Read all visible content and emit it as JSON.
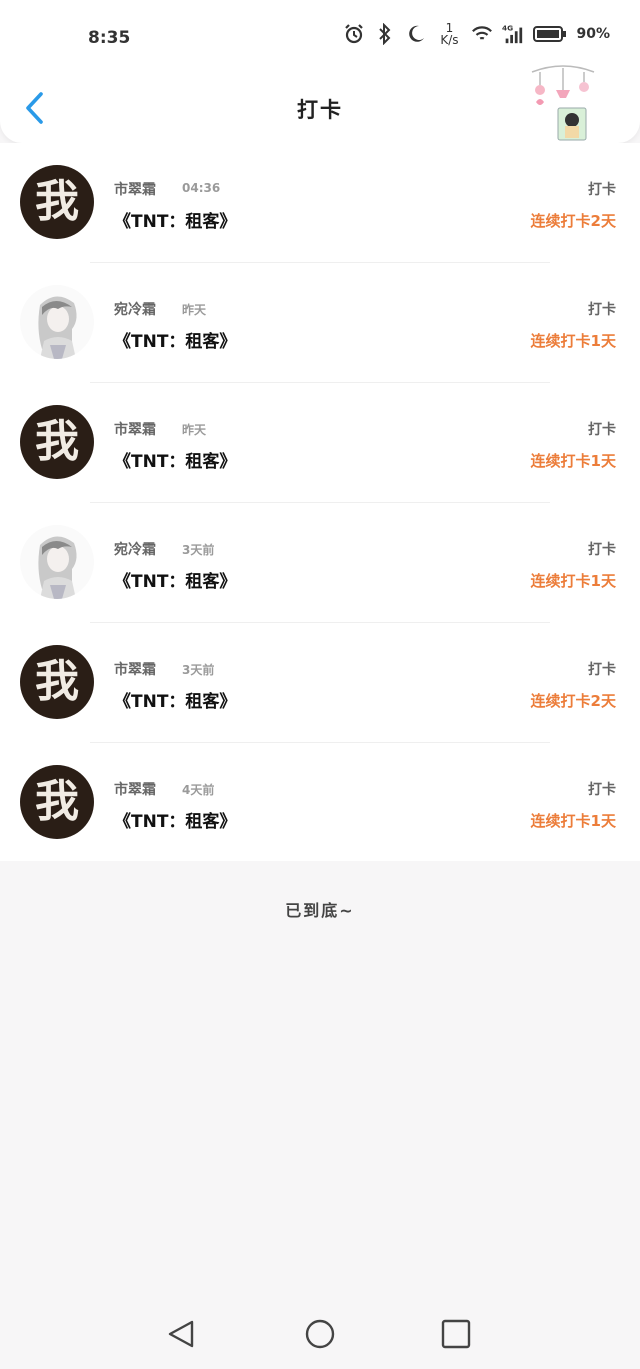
{
  "status": {
    "time": "8:35",
    "speed_top": "1",
    "speed_bottom": "K/s",
    "network": "4G",
    "battery": "90%"
  },
  "header": {
    "title": "打卡"
  },
  "colors": {
    "accent_blue": "#2a9ae8",
    "streak_orange": "#ec7d3a"
  },
  "rows": [
    {
      "avatar": "我",
      "avatar_kind": "wo-char",
      "name": "市翠霜",
      "time": "04:36",
      "book": "《TNT：租客》",
      "tag": "打卡",
      "streak": "连续打卡2天"
    },
    {
      "avatar": "",
      "avatar_kind": "girl-portrait",
      "name": "宛冷霜",
      "time": "昨天",
      "book": "《TNT：租客》",
      "tag": "打卡",
      "streak": "连续打卡1天"
    },
    {
      "avatar": "我",
      "avatar_kind": "wo-char",
      "name": "市翠霜",
      "time": "昨天",
      "book": "《TNT：租客》",
      "tag": "打卡",
      "streak": "连续打卡1天"
    },
    {
      "avatar": "",
      "avatar_kind": "girl-portrait",
      "name": "宛冷霜",
      "time": "3天前",
      "book": "《TNT：租客》",
      "tag": "打卡",
      "streak": "连续打卡1天"
    },
    {
      "avatar": "我",
      "avatar_kind": "wo-char",
      "name": "市翠霜",
      "time": "3天前",
      "book": "《TNT：租客》",
      "tag": "打卡",
      "streak": "连续打卡2天"
    },
    {
      "avatar": "我",
      "avatar_kind": "wo-char",
      "name": "市翠霜",
      "time": "4天前",
      "book": "《TNT：租客》",
      "tag": "打卡",
      "streak": "连续打卡1天"
    }
  ],
  "footer": {
    "end_text": "已到底~"
  }
}
